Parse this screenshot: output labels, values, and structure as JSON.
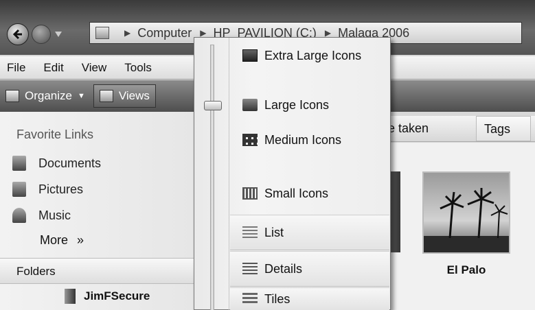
{
  "address_bar": {
    "crumbs": [
      "Computer",
      "HP_PAVILION (C:)",
      "Malaga 2006"
    ]
  },
  "menubar": {
    "items": [
      "File",
      "Edit",
      "View",
      "Tools"
    ]
  },
  "toolbar": {
    "organize_label": "Organize",
    "views_label": "Views"
  },
  "columns": {
    "date_taken": "Date taken",
    "tags": "Tags"
  },
  "navigation": {
    "favorite_heading": "Favorite Links",
    "favorites": [
      "Documents",
      "Pictures",
      "Music"
    ],
    "more_label": "More",
    "more_glyph": "»",
    "folders_heading": "Folders",
    "tree_item": "JimFSecure"
  },
  "content": {
    "thumbnail_caption": "El Palo"
  },
  "views_menu": {
    "items": [
      "Extra Large Icons",
      "Large Icons",
      "Medium Icons",
      "Small Icons",
      "List",
      "Details",
      "Tiles"
    ],
    "slider_level_fraction": 0.78
  }
}
